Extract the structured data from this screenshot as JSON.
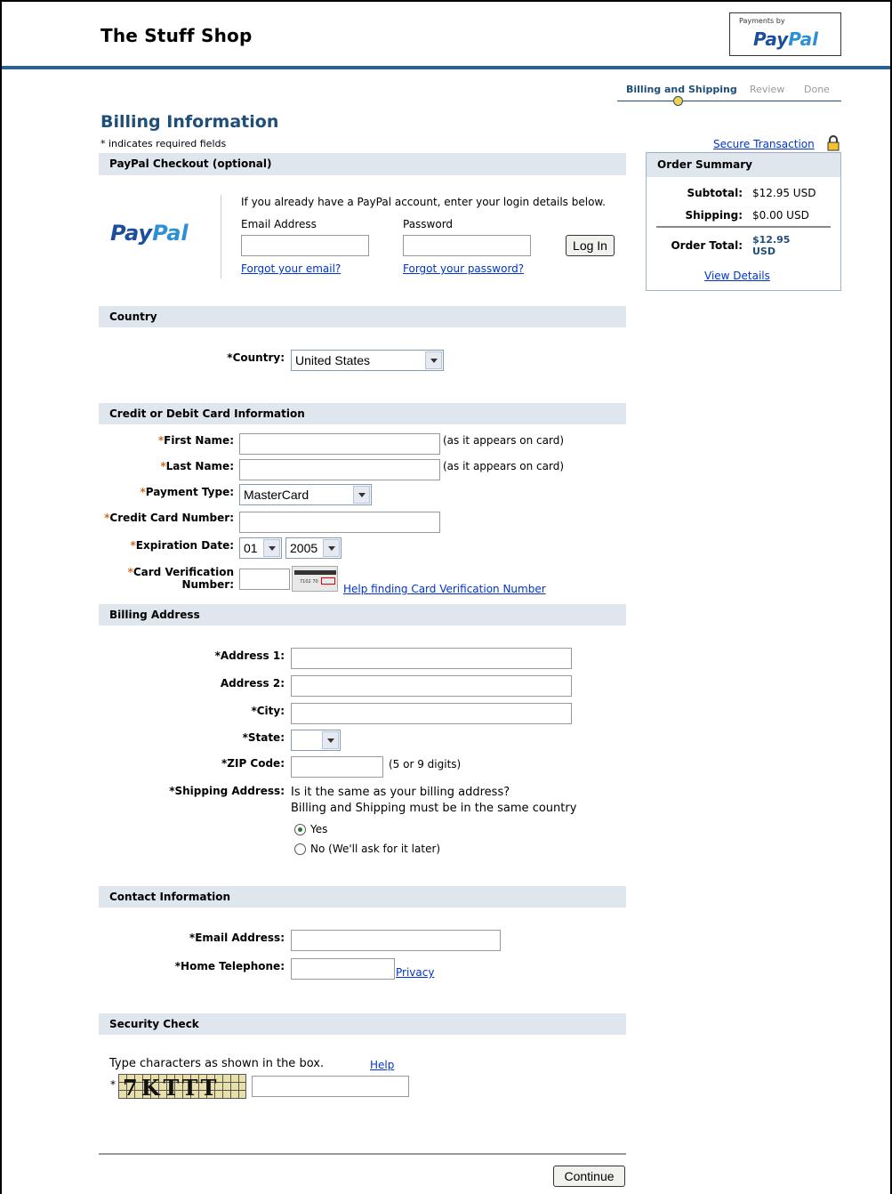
{
  "header": {
    "site_title": "The Stuff Shop",
    "badge_small": "Payments by",
    "badge_logo_1": "Pay",
    "badge_logo_2": "Pal"
  },
  "steps": [
    "Billing and Shipping",
    "Review",
    "Done"
  ],
  "page": {
    "title": "Billing Information",
    "required_note": "* indicates required fields",
    "secure_link": "Secure Transaction"
  },
  "paypal_checkout": {
    "header": "PayPal Checkout (optional)",
    "logo_1": "Pay",
    "logo_2": "Pal",
    "intro": "If you already have a PayPal account, enter your login details below.",
    "email_label": "Email Address",
    "password_label": "Password",
    "login_button": "Log In",
    "forgot_email": "Forgot your email?",
    "forgot_password": "Forgot your password?"
  },
  "order_summary": {
    "header": "Order Summary",
    "subtotal_label": "Subtotal:",
    "subtotal_value": "$12.95 USD",
    "shipping_label": "Shipping:",
    "shipping_value": "$0.00 USD",
    "total_label": "Order Total:",
    "total_value_line1": "$12.95",
    "total_value_line2": "USD",
    "view_details": "View Details"
  },
  "country_section": {
    "header": "Country",
    "label": "Country:",
    "selected": "United States"
  },
  "card_section": {
    "header": "Credit or Debit Card Information",
    "first_name_label": "First Name:",
    "last_name_label": "Last Name:",
    "as_on_card": "(as it appears on card)",
    "payment_type_label": "Payment Type:",
    "payment_type_value": "MasterCard",
    "card_number_label": "Credit Card Number:",
    "expiration_label": "Expiration Date:",
    "exp_month": "01",
    "exp_year": "2005",
    "cvn_label_1": "Card Verification",
    "cvn_label_2": "Number:",
    "cvn_help": "Help finding Card Verification Number"
  },
  "billing_section": {
    "header": "Billing Address",
    "address1_label": "Address 1:",
    "address2_label": "Address 2:",
    "city_label": "City:",
    "state_label": "State:",
    "zip_label": "ZIP Code:",
    "zip_note": "(5 or 9 digits)",
    "shipping_label": "Shipping Address:",
    "shipping_q1": "Is it the same as your billing address?",
    "shipping_q2": "Billing and Shipping must be in the same country",
    "yes": "Yes",
    "no": "No (We'll ask for it later)"
  },
  "contact_section": {
    "header": "Contact Information",
    "email_label": "Email Address:",
    "phone_label": "Home Telephone:",
    "privacy_link": "Privacy"
  },
  "security_section": {
    "header": "Security Check",
    "instruction": "Type characters as shown in the box.",
    "help_link": "Help",
    "captcha_text": "7KTTT"
  },
  "footer": {
    "continue_button": "Continue"
  },
  "colors": {
    "accent": "#1f4e79",
    "section_bg": "#dfe6ee",
    "link": "#0033cc",
    "required_star": "#d2691e"
  }
}
